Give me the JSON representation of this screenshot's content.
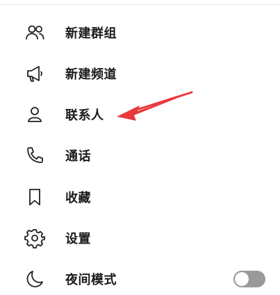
{
  "menu": {
    "items": [
      {
        "label": "新建群组",
        "icon": "users-icon"
      },
      {
        "label": "新建频道",
        "icon": "megaphone-icon"
      },
      {
        "label": "联系人",
        "icon": "person-icon"
      },
      {
        "label": "通话",
        "icon": "phone-icon"
      },
      {
        "label": "收藏",
        "icon": "bookmark-icon"
      },
      {
        "label": "设置",
        "icon": "gear-icon"
      },
      {
        "label": "夜间模式",
        "icon": "moon-icon"
      }
    ]
  },
  "night_mode_toggle": {
    "state": "off"
  },
  "annotation": {
    "type": "arrow",
    "color": "#e8383b",
    "points_to": "联系人"
  },
  "colors": {
    "text": "#1a1a1a",
    "icon": "#1f1f1f",
    "toggle_off": "#9a9a9a",
    "arrow": "#e8383b",
    "background": "#ffffff"
  }
}
